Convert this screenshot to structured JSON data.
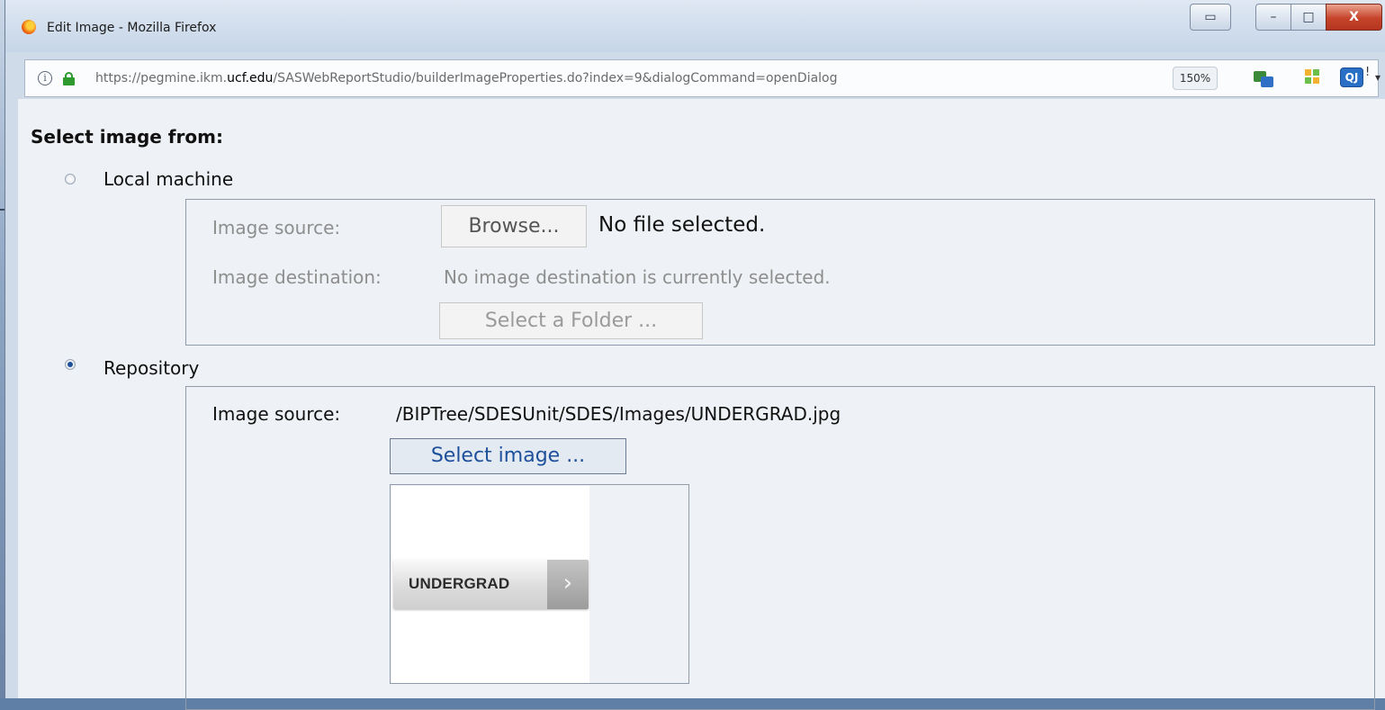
{
  "window": {
    "title": "Edit Image - Mozilla Firefox",
    "controls": {
      "minimize": "–",
      "maximize": "□",
      "close": "X"
    }
  },
  "toolbar": {
    "url_prefix": "https://pegmine.ikm.",
    "url_domain": "ucf.edu",
    "url_path": "/SASWebReportStudio/builderImageProperties.do?index=9&dialogCommand=openDialog",
    "zoom": "150%",
    "profile_badge": "QJ",
    "profile_badge_suffix": "!",
    "menu_caret": "▾",
    "info_glyph": "i"
  },
  "dialog": {
    "heading": "Select image from:",
    "local": {
      "label": "Local machine",
      "selected": false,
      "image_source_label": "Image source:",
      "browse_label": "Browse...",
      "no_file_text": "No file selected.",
      "image_destination_label": "Image destination:",
      "image_destination_value": "No image destination is currently selected.",
      "select_folder_label": "Select a Folder ..."
    },
    "repository": {
      "label": "Repository",
      "selected": true,
      "image_source_label": "Image source:",
      "image_source_value": "/BIPTree/SDESUnit/SDES/Images/UNDERGRAD.jpg",
      "select_image_label": "Select image ...",
      "preview": {
        "button_text": "UNDERGRAD",
        "arrow": "›"
      }
    }
  },
  "colors": {
    "accent": "#1e4f9a",
    "disabled_text": "#8e8e8e",
    "close_button": "#c6432a"
  }
}
